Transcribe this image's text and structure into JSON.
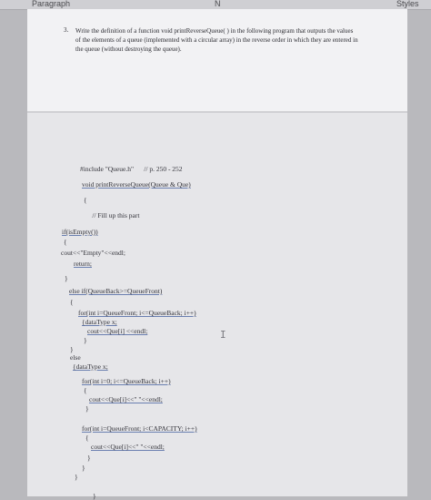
{
  "ribbon": {
    "left_label": "Paragraph",
    "middle_label": "N",
    "right_label": "Styles"
  },
  "question": {
    "number": "3.",
    "text": "Write the definition of a function void printReverseQueue( ) in the following program that outputs the values of the elements of a queue (implemented with a circular array) in the reverse order in which they are entered in the queue (without destroying the queue)."
  },
  "code_lines": [
    "#include \"Queue.h\"      // p. 250 - 252",
    "void printReverseQueue(Queue & Que)",
    "{",
    "     // Fill up this part",
    "if(isEmpty())",
    "{",
    "cout<<\"Empty\"<<endl;",
    "return;",
    "}",
    "else if(QueueBack>=QueueFront)",
    "{",
    "for(int i=QueueFront; i<=QueueBack; i++)",
    "{dataType x;",
    "cout<<Que[i] <<endl;",
    "}",
    "}",
    "else",
    "{dataType x;",
    "for(int i=0; i<=QueueBack; i++)",
    "{",
    "cout<<Que[i]<<\" \"<<endl;",
    "}",
    "for(int i=QueueFront; i<CAPACITY; i++)",
    "{",
    "cout<<Que[i]<<\" \"<<endl;",
    "}",
    "}",
    "}",
    "}"
  ],
  "cursor_glyph": "I"
}
